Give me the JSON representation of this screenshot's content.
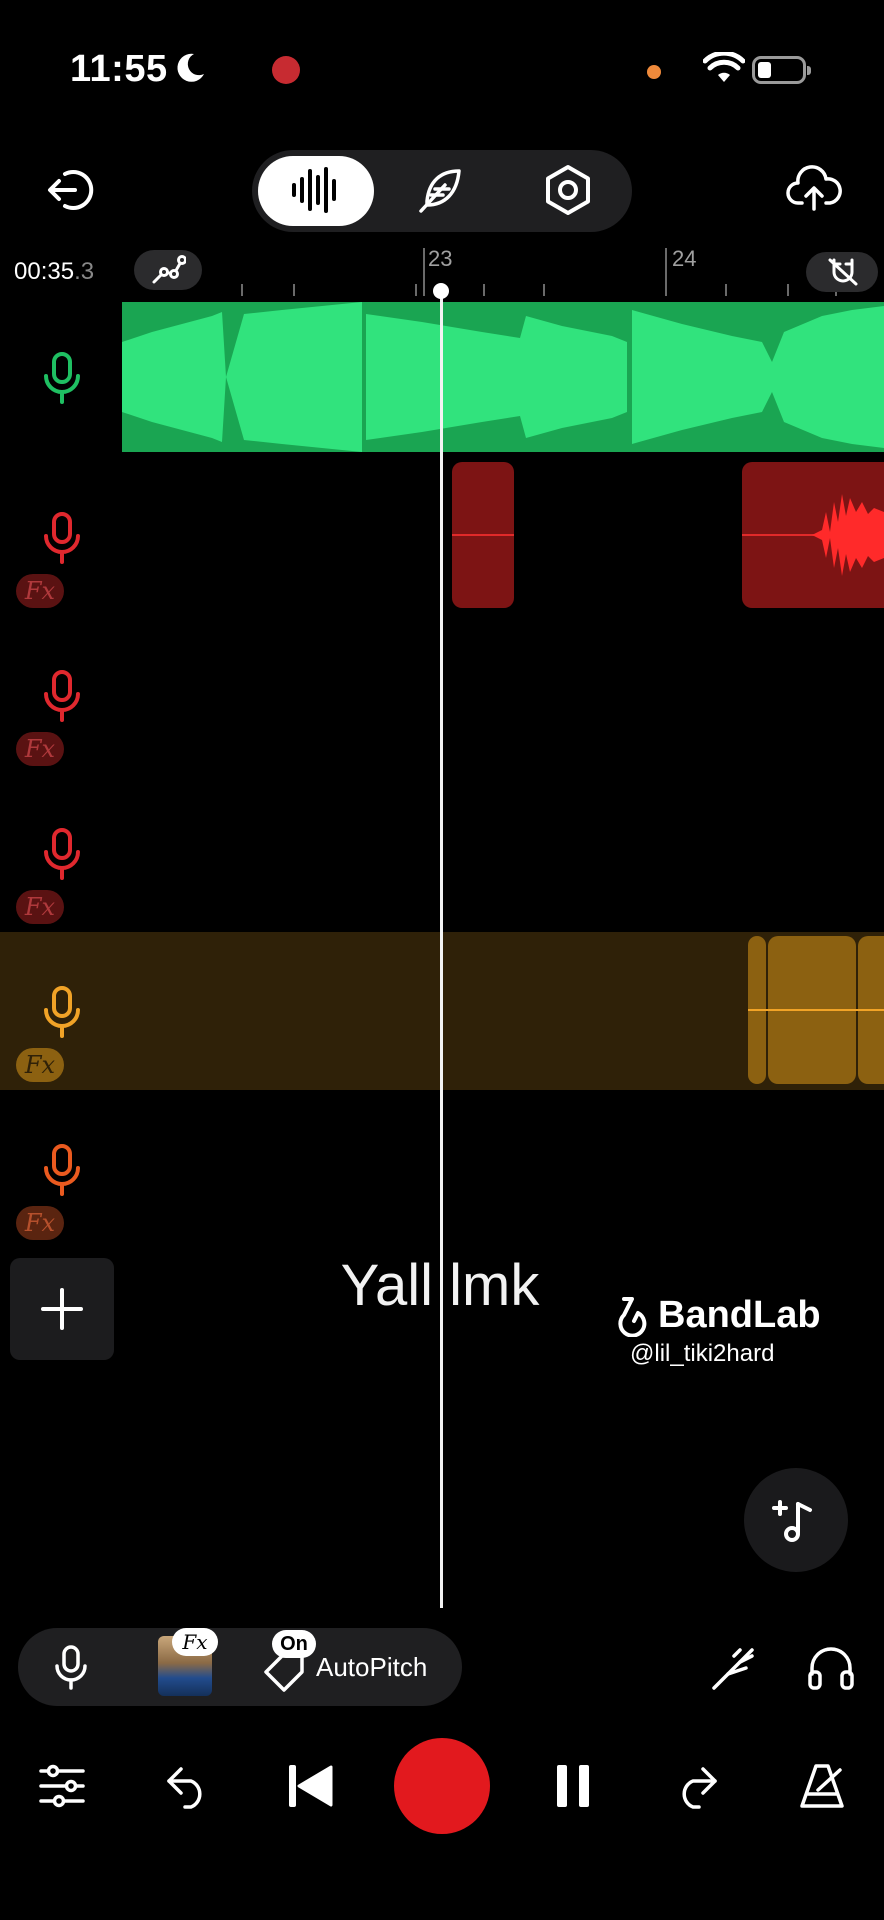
{
  "status_bar": {
    "time": "11:55",
    "icons": [
      "moon-icon",
      "recording-indicator",
      "mic-in-use-dot",
      "wifi-icon",
      "battery-icon"
    ]
  },
  "header": {
    "back_icon": "exit-icon",
    "modes": [
      "waveform-icon",
      "feather-icon",
      "hexagon-settings-icon"
    ],
    "active_mode": "waveform",
    "upload_icon": "cloud-upload-icon"
  },
  "timeline": {
    "timecode_main": "00:35",
    "timecode_frac": ".3",
    "bars": [
      "23",
      "24"
    ],
    "automation_icon": "automation-icon",
    "snap_icon": "magnet-off-icon"
  },
  "tracks": [
    {
      "color": "#1fbf62",
      "fx": false,
      "icon": "mic-icon"
    },
    {
      "color": "#e0282e",
      "fx": true,
      "fx_label": "Fx",
      "icon": "mic-icon"
    },
    {
      "color": "#e0282e",
      "fx": true,
      "fx_label": "Fx",
      "icon": "mic-icon"
    },
    {
      "color": "#e0282e",
      "fx": true,
      "fx_label": "Fx",
      "icon": "mic-icon"
    },
    {
      "color": "#f1a327",
      "fx": true,
      "fx_label": "Fx",
      "icon": "mic-icon"
    },
    {
      "color": "#ea5a1f",
      "fx": true,
      "fx_label": "Fx",
      "icon": "mic-icon"
    }
  ],
  "overlay": {
    "lyric": "Yall lmk",
    "brand": "BandLab",
    "handle": "@lil_tiki2hard"
  },
  "bottom_tools": {
    "fx_label": "Fx",
    "on_label": "On",
    "autopitch_label": "AutoPitch",
    "tuner_icon": "tuning-fork-icon",
    "headphones_icon": "headphones-icon"
  },
  "transport": [
    "mixer-icon",
    "undo-icon",
    "skip-back-icon",
    "record-button",
    "pause-icon",
    "redo-icon",
    "metronome-icon"
  ],
  "colors": {
    "green": "#1aa552",
    "red_clip": "#7d1414",
    "yellow_lane": "#2f2108",
    "yellow_clip": "#8c6111",
    "record": "#e2191e"
  }
}
